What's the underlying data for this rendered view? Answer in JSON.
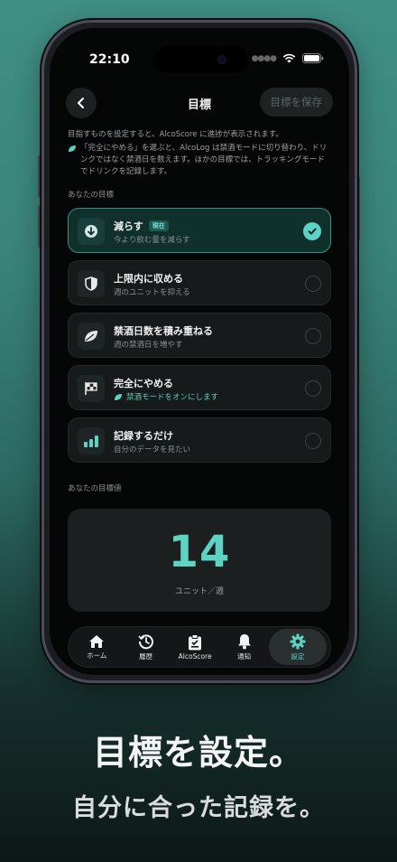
{
  "status": {
    "time": "22:10"
  },
  "nav": {
    "title": "目標",
    "save_label": "目標を保存"
  },
  "description": {
    "line1": "目指すものを設定すると、AlcoScore に進捗が表示されます。",
    "line2": "「完全にやめる」を選ぶと、AlcoLog は禁酒モードに切り替わり、ドリンクではなく禁酒日を数えます。ほかの目標では、トラッキングモードでドリンクを記録します。"
  },
  "goals_section_label": "あなたの目標",
  "goals": [
    {
      "title": "減らす",
      "badge": "現在",
      "subtitle": "今より飲む量を減らす",
      "icon": "arrow-down-circle-icon",
      "selected": true
    },
    {
      "title": "上限内に収める",
      "subtitle": "週のユニットを抑える",
      "icon": "shield-icon",
      "selected": false
    },
    {
      "title": "禁酒日数を積み重ねる",
      "subtitle": "週の禁酒日を増やす",
      "icon": "leaf-icon",
      "selected": false
    },
    {
      "title": "完全にやめる",
      "subtitle": "禁酒モードをオンにします",
      "icon": "flag-icon",
      "selected": false
    },
    {
      "title": "記録するだけ",
      "subtitle": "自分のデータを見たい",
      "icon": "bar-chart-icon",
      "selected": false
    }
  ],
  "target_section_label": "あなたの目標値",
  "target": {
    "value": "14",
    "unit": "ユニット／週"
  },
  "tabs": [
    {
      "label": "ホーム",
      "icon": "home-icon"
    },
    {
      "label": "履歴",
      "icon": "history-icon"
    },
    {
      "label": "AlcoScore",
      "icon": "clipboard-icon"
    },
    {
      "label": "通知",
      "icon": "bell-icon"
    },
    {
      "label": "設定",
      "icon": "gear-icon",
      "active": true
    }
  ],
  "promo": {
    "headline": "目標を設定。",
    "subhead": "自分に合った記録を。"
  },
  "colors": {
    "accent": "#5dd3c3",
    "background_top": "#3f8f85",
    "screen_bg": "#050606"
  }
}
